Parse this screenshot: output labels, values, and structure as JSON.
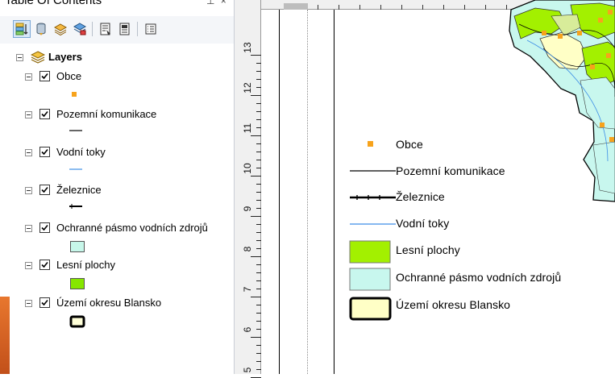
{
  "toc": {
    "title": "Table Of Contents",
    "pin_glyphs": "⊥ ×",
    "toolbar": [
      {
        "name": "list-by-drawing-order-button",
        "icon": "list-by-drawing-order-icon",
        "active": true
      },
      {
        "name": "list-by-source-button",
        "icon": "database-icon"
      },
      {
        "name": "list-by-visibility-button",
        "icon": "layers-visibility-icon"
      },
      {
        "name": "list-by-selection-button",
        "icon": "selection-icon"
      },
      {
        "name": "add-data-button",
        "icon": "map-document-icon"
      },
      {
        "name": "options-button",
        "icon": "document-options-icon"
      },
      {
        "name": "options-list-button",
        "icon": "list-options-icon"
      }
    ],
    "root_label": "Layers",
    "layers": [
      {
        "label": "Obce",
        "checked": true,
        "symbol": "point",
        "color": "#f7a31c"
      },
      {
        "label": "Pozemní komunikace",
        "checked": true,
        "symbol": "line-black",
        "color": "#000000"
      },
      {
        "label": "Vodní toky",
        "checked": true,
        "symbol": "line-blue",
        "color": "#3d8ee6"
      },
      {
        "label": "Železnice",
        "checked": true,
        "symbol": "rail",
        "color": "#000000"
      },
      {
        "label": "Ochranné pásmo vodních zdrojů",
        "checked": true,
        "symbol": "polygon",
        "color": "#c7f7ea"
      },
      {
        "label": "Lesní plochy",
        "checked": true,
        "symbol": "polygon",
        "color": "#86e600"
      },
      {
        "label": "Území okresu Blansko",
        "checked": true,
        "symbol": "outline",
        "color": "#ffffd9"
      }
    ]
  },
  "ruler": {
    "numbers": [
      "13",
      "12",
      "11",
      "10",
      "9",
      "8",
      "7",
      "6",
      "5"
    ]
  },
  "legend": {
    "items": [
      {
        "label": "Obce",
        "symbol": "point",
        "color": "#f7a31c"
      },
      {
        "label": "Pozemní komunikace",
        "symbol": "line-black",
        "color": "#000000"
      },
      {
        "label": "Železnice",
        "symbol": "rail",
        "color": "#000000"
      },
      {
        "label": "Vodní toky",
        "symbol": "line-blue",
        "color": "#3d8ee6"
      },
      {
        "label": "Lesní plochy",
        "symbol": "polygon",
        "color": "#a3f000"
      },
      {
        "label": "Ochranné pásmo vodních zdrojů",
        "symbol": "polygon",
        "color": "#c8f7ee"
      },
      {
        "label": "Území okresu Blansko",
        "symbol": "outline",
        "color": "#ffffc6"
      }
    ]
  },
  "map": {
    "colors": {
      "forest": "#a3f000",
      "protection": "#c8f7ee",
      "district": "#ffffc6",
      "town": "#f7a31c",
      "land": "#d8ec9a"
    }
  }
}
